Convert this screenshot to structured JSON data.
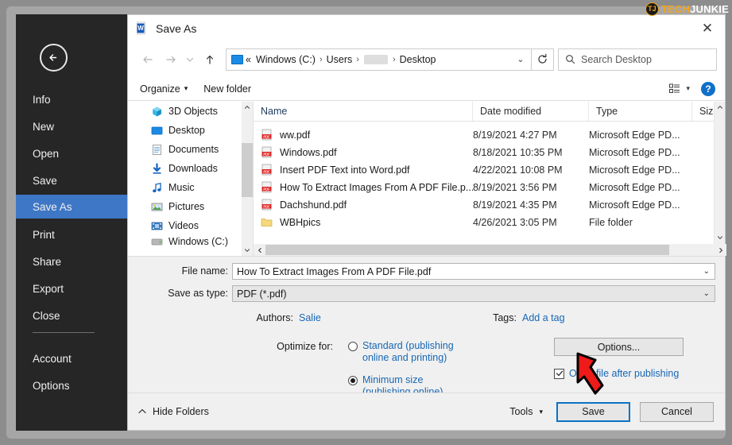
{
  "watermark": {
    "logo_text": "TJ",
    "brand_part1": "TECH",
    "brand_part2": "JUNKIE"
  },
  "backstage": {
    "back_icon": "back-arrow-icon",
    "items": [
      {
        "label": "Info",
        "selected": false
      },
      {
        "label": "New",
        "selected": false
      },
      {
        "label": "Open",
        "selected": false
      },
      {
        "label": "Save",
        "selected": false
      },
      {
        "label": "Save As",
        "selected": true
      },
      {
        "label": "Print",
        "selected": false
      },
      {
        "label": "Share",
        "selected": false
      },
      {
        "label": "Export",
        "selected": false
      },
      {
        "label": "Close",
        "selected": false
      },
      {
        "label": "Account",
        "selected": false
      },
      {
        "label": "Options",
        "selected": false
      }
    ],
    "selected_color": "#3e77c5"
  },
  "dialog": {
    "title": "Save As",
    "app_icon": "word-document-icon",
    "close_label": "✕",
    "nav": {
      "back_icon": "arrow-left-icon",
      "forward_icon": "arrow-right-icon",
      "recent_icon": "chevron-down-icon",
      "up_icon": "arrow-up-icon",
      "refresh_icon": "refresh-icon",
      "address_dropdown_icon": "chevron-down-icon",
      "drive_icon": "monitor-icon",
      "breadcrumbs": [
        "«",
        "Windows (C:)",
        "Users",
        "",
        "Desktop"
      ],
      "breadcrumb_separator": "›",
      "redacted_index": 3
    },
    "search": {
      "icon": "search-icon",
      "placeholder": "Search Desktop",
      "value": ""
    },
    "commandbar": {
      "organize_label": "Organize",
      "organize_caret": "▾",
      "new_folder_label": "New folder",
      "view_icon": "view-list-icon",
      "view_caret": "▾",
      "help_label": "?"
    },
    "navpane": {
      "items": [
        {
          "label": "3D Objects",
          "icon": "3d-objects-icon"
        },
        {
          "label": "Desktop",
          "icon": "desktop-icon"
        },
        {
          "label": "Documents",
          "icon": "documents-icon"
        },
        {
          "label": "Downloads",
          "icon": "downloads-icon"
        },
        {
          "label": "Music",
          "icon": "music-icon"
        },
        {
          "label": "Pictures",
          "icon": "pictures-icon"
        },
        {
          "label": "Videos",
          "icon": "videos-icon"
        },
        {
          "label": "Windows (C:)",
          "icon": "drive-icon"
        }
      ],
      "scroll_up_icon": "chevron-up-icon",
      "scroll_down_icon": "chevron-down-icon"
    },
    "filelist": {
      "columns": [
        "Name",
        "Date modified",
        "Type",
        "Size"
      ],
      "sort_indicator_icon": "chevron-up-icon",
      "rows": [
        {
          "name": "ww.pdf",
          "date": "8/19/2021 4:27 PM",
          "type": "Microsoft Edge PD...",
          "size": "",
          "icon": "pdf-file-icon"
        },
        {
          "name": "Windows.pdf",
          "date": "8/18/2021 10:35 PM",
          "type": "Microsoft Edge PD...",
          "size": "",
          "icon": "pdf-file-icon"
        },
        {
          "name": "Insert PDF Text into Word.pdf",
          "date": "4/22/2021 10:08 PM",
          "type": "Microsoft Edge PD...",
          "size": "",
          "icon": "pdf-file-icon"
        },
        {
          "name": "How To Extract Images From A PDF File.p...",
          "date": "8/19/2021 3:56 PM",
          "type": "Microsoft Edge PD...",
          "size": "",
          "icon": "pdf-file-icon"
        },
        {
          "name": "Dachshund.pdf",
          "date": "8/19/2021 4:35 PM",
          "type": "Microsoft Edge PD...",
          "size": "",
          "icon": "pdf-file-icon"
        },
        {
          "name": "WBHpics",
          "date": "4/26/2021 3:05 PM",
          "type": "File folder",
          "size": "",
          "icon": "folder-icon"
        }
      ],
      "hscroll_left_icon": "chevron-left-icon",
      "hscroll_right_icon": "chevron-right-icon"
    },
    "form": {
      "filename_label": "File name:",
      "filename_value": "How To Extract Images From A PDF File.pdf",
      "savetype_label": "Save as type:",
      "savetype_value": "PDF (*.pdf)",
      "combo_caret": "⌄",
      "authors_label": "Authors:",
      "authors_value": "Salie",
      "tags_label": "Tags:",
      "tags_value": "Add a tag",
      "optimize_label": "Optimize for:",
      "optimize_options": [
        {
          "line1": "Standard (publishing",
          "line2": "online and printing)",
          "selected": false
        },
        {
          "line1": "Minimum size",
          "line2": "(publishing online)",
          "selected": true
        }
      ],
      "options_button_label": "Options...",
      "open_after_label": "Open file after publishing",
      "open_after_checked": true,
      "check_glyph": "✓"
    },
    "footer": {
      "hide_folders_caret": "˄",
      "hide_folders_label": "Hide Folders",
      "tools_label": "Tools",
      "tools_caret": "▾",
      "save_label": "Save",
      "cancel_label": "Cancel"
    }
  },
  "annotation": {
    "arrow_icon": "red-down-arrow",
    "color": "#ef1a1a",
    "target": "save-button"
  }
}
